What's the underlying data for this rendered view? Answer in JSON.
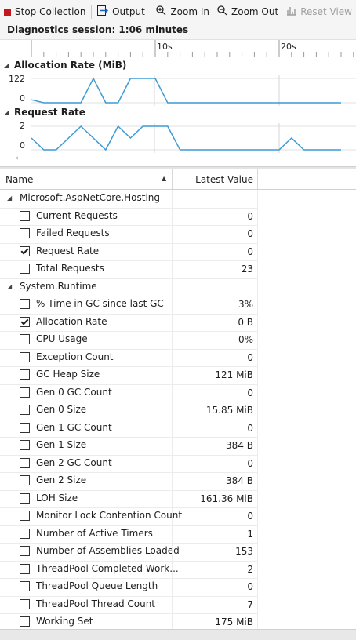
{
  "toolbar": {
    "stop_label": "Stop Collection",
    "output_label": "Output",
    "zoom_in_label": "Zoom In",
    "zoom_out_label": "Zoom Out",
    "reset_label": "Reset View"
  },
  "session": {
    "label": "Diagnostics session: 1:06 minutes"
  },
  "ruler": {
    "ticks": [
      "10s",
      "20s"
    ]
  },
  "graphs": [
    {
      "title": "Allocation Rate (MiB)",
      "ymax_label": "122",
      "ymin_label": "0"
    },
    {
      "title": "Request Rate",
      "ymax_label": "2",
      "ymin_label": "0"
    }
  ],
  "chart_data": [
    {
      "type": "line",
      "title": "Allocation Rate (MiB)",
      "ylim": [
        0,
        122
      ],
      "x": [
        0,
        1,
        2,
        3,
        4,
        5,
        6,
        7,
        8,
        9,
        10,
        11,
        12,
        13,
        14,
        15,
        16,
        17,
        18,
        19,
        20,
        21,
        22,
        23,
        24,
        25
      ],
      "values": [
        15,
        0,
        0,
        0,
        0,
        122,
        0,
        0,
        122,
        122,
        122,
        0,
        0,
        0,
        0,
        0,
        0,
        0,
        0,
        0,
        0,
        0,
        0,
        0,
        0,
        0
      ]
    },
    {
      "type": "line",
      "title": "Request Rate",
      "ylim": [
        0,
        2
      ],
      "x": [
        0,
        1,
        2,
        3,
        4,
        5,
        6,
        7,
        8,
        9,
        10,
        11,
        12,
        13,
        14,
        15,
        16,
        17,
        18,
        19,
        20,
        21,
        22,
        23,
        24,
        25
      ],
      "values": [
        1,
        0,
        0,
        1,
        2,
        1,
        0,
        2,
        1,
        2,
        2,
        2,
        0,
        0,
        0,
        0,
        0,
        0,
        0,
        0,
        0,
        1,
        0,
        0,
        0,
        0
      ]
    }
  ],
  "grid": {
    "col_name": "Name",
    "col_value": "Latest Value",
    "rows": [
      {
        "kind": "group",
        "label": "Microsoft.AspNetCore.Hosting"
      },
      {
        "kind": "item",
        "label": "Current Requests",
        "value": "0",
        "checked": false
      },
      {
        "kind": "item",
        "label": "Failed Requests",
        "value": "0",
        "checked": false
      },
      {
        "kind": "item",
        "label": "Request Rate",
        "value": "0",
        "checked": true
      },
      {
        "kind": "item",
        "label": "Total Requests",
        "value": "23",
        "checked": false
      },
      {
        "kind": "group",
        "label": "System.Runtime"
      },
      {
        "kind": "item",
        "label": "% Time in GC since last GC",
        "value": "3%",
        "checked": false
      },
      {
        "kind": "item",
        "label": "Allocation Rate",
        "value": "0 B",
        "checked": true
      },
      {
        "kind": "item",
        "label": "CPU Usage",
        "value": "0%",
        "checked": false
      },
      {
        "kind": "item",
        "label": "Exception Count",
        "value": "0",
        "checked": false
      },
      {
        "kind": "item",
        "label": "GC Heap Size",
        "value": "121 MiB",
        "checked": false
      },
      {
        "kind": "item",
        "label": "Gen 0 GC Count",
        "value": "0",
        "checked": false
      },
      {
        "kind": "item",
        "label": "Gen 0 Size",
        "value": "15.85 MiB",
        "checked": false
      },
      {
        "kind": "item",
        "label": "Gen 1 GC Count",
        "value": "0",
        "checked": false
      },
      {
        "kind": "item",
        "label": "Gen 1 Size",
        "value": "384 B",
        "checked": false
      },
      {
        "kind": "item",
        "label": "Gen 2 GC Count",
        "value": "0",
        "checked": false
      },
      {
        "kind": "item",
        "label": "Gen 2 Size",
        "value": "384 B",
        "checked": false
      },
      {
        "kind": "item",
        "label": "LOH Size",
        "value": "161.36 MiB",
        "checked": false
      },
      {
        "kind": "item",
        "label": "Monitor Lock Contention Count",
        "value": "0",
        "checked": false
      },
      {
        "kind": "item",
        "label": "Number of Active Timers",
        "value": "1",
        "checked": false
      },
      {
        "kind": "item",
        "label": "Number of Assemblies Loaded",
        "value": "153",
        "checked": false
      },
      {
        "kind": "item",
        "label": "ThreadPool Completed Work...",
        "value": "2",
        "checked": false
      },
      {
        "kind": "item",
        "label": "ThreadPool Queue Length",
        "value": "0",
        "checked": false
      },
      {
        "kind": "item",
        "label": "ThreadPool Thread Count",
        "value": "7",
        "checked": false
      },
      {
        "kind": "item",
        "label": "Working Set",
        "value": "175 MiB",
        "checked": false
      }
    ]
  },
  "colors": {
    "accent_stop": "#c4161c",
    "line": "#3c9ad6"
  }
}
